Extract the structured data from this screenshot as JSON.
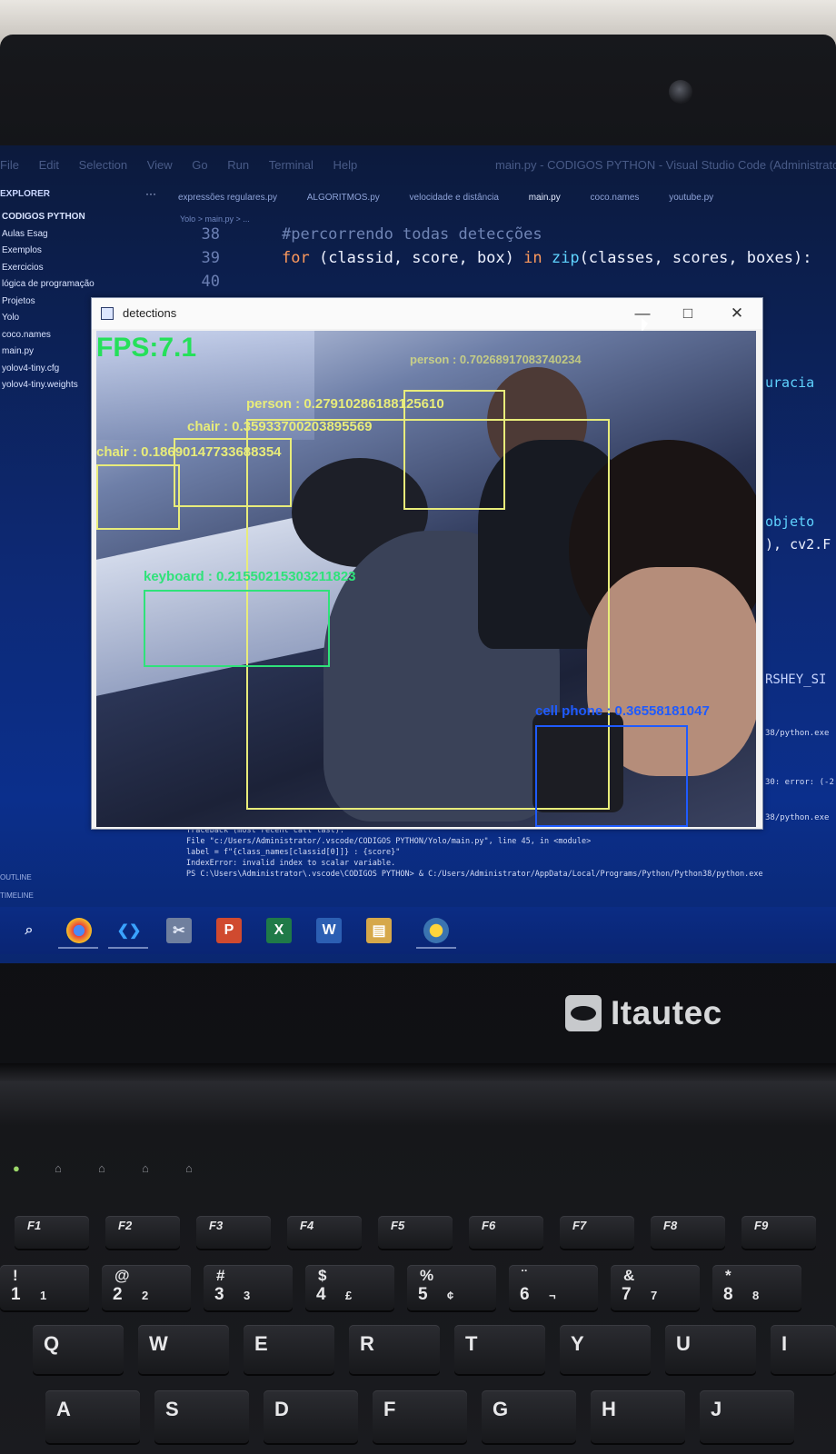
{
  "menubar": {
    "items": [
      "File",
      "Edit",
      "Selection",
      "View",
      "Go",
      "Run",
      "Terminal",
      "Help"
    ],
    "title": "main.py - CODIGOS PYTHON - Visual Studio Code (Administrator)"
  },
  "explorer": {
    "header": "EXPLORER",
    "root": "CODIGOS PYTHON",
    "items": [
      "Aulas Esag",
      "Exemplos",
      "Exercicios",
      "lógica de programação",
      "Projetos",
      "Yolo",
      "coco.names",
      "main.py",
      "yolov4-tiny.cfg",
      "yolov4-tiny.weights"
    ],
    "outline": "OUTLINE",
    "timeline": "TIMELINE"
  },
  "tabs": [
    "expressões regulares.py",
    "ALGORITMOS.py",
    "velocidade e distância",
    "main.py",
    "coco.names",
    "youtube.py"
  ],
  "breadcrumb": "Yolo > main.py > ...",
  "code": [
    {
      "ln": "38",
      "text": "#percorrendo todas detecções"
    },
    {
      "ln": "39",
      "kw": "for",
      "pl1": " (classid, score, box) ",
      "kw2": "in",
      "fn": " zip",
      "pl2": "(classes, scores, boxes):"
    },
    {
      "ln": "40",
      "text": ""
    }
  ],
  "right_code": [
    "uracia",
    "objeto",
    "), cv2.F",
    "RSHEY_SI",
    "38/python.exe",
    "30: error: (-2",
    "38/python.exe"
  ],
  "window": {
    "title": "detections",
    "minimize": "—",
    "maximize": "□",
    "close": "✕",
    "fps": "FPS:7.1"
  },
  "detections": [
    {
      "label": "chair : 0.18690147733688354",
      "color": "#e8ec7a"
    },
    {
      "label": "chair : 0.35933700203895569",
      "color": "#e8ec7a"
    },
    {
      "label": "person : 0.27910286188125610",
      "color": "#e8ec7a"
    },
    {
      "label": "person : 0.70268917083740234",
      "color": "#e8ec7a"
    },
    {
      "label": "keyboard : 0.21550215303211823",
      "color": "#2fe27a"
    },
    {
      "label": "cell phone : 0.36558181047",
      "color": "#1f5bff"
    }
  ],
  "terminal": [
    "Traceback (most recent call last):",
    "  File \"c:/Users/Administrator/.vscode/CODIGOS PYTHON/Yolo/main.py\", line 45, in <module>",
    "    label = f\"{class_names[classid[0]]} : {score}\"",
    "IndexError: invalid index to scalar variable.",
    "PS C:\\Users\\Administrator\\.vscode\\CODIGOS PYTHON> & C:/Users/Administrator/AppData/Local/Programs/Python/Python38/python.exe"
  ],
  "taskbar": [
    "search",
    "chrome",
    "vscode",
    "snipping",
    "powerpoint",
    "excel",
    "word",
    "explorer",
    "python"
  ],
  "brand": "Itautec",
  "keyboard": {
    "fkeys": [
      "F1",
      "F2",
      "F3",
      "F4",
      "F5",
      "F6",
      "F7",
      "F8",
      "F9"
    ],
    "numbers": [
      {
        "top": "!",
        "bottom": "1",
        "sub": "1"
      },
      {
        "top": "@",
        "bottom": "2",
        "sub": "2"
      },
      {
        "top": "#",
        "bottom": "3",
        "sub": "3"
      },
      {
        "top": "$",
        "bottom": "4",
        "sub": "£"
      },
      {
        "top": "%",
        "bottom": "5",
        "sub": "¢"
      },
      {
        "top": "¨",
        "bottom": "6",
        "sub": "¬"
      },
      {
        "top": "&",
        "bottom": "7",
        "sub": "7"
      },
      {
        "top": "*",
        "bottom": "8",
        "sub": "8"
      }
    ],
    "qrow": [
      "Q",
      "W",
      "E",
      "R",
      "T",
      "Y",
      "U",
      "I"
    ],
    "arow": [
      "A",
      "S",
      "D",
      "F",
      "G",
      "H",
      "J"
    ]
  }
}
